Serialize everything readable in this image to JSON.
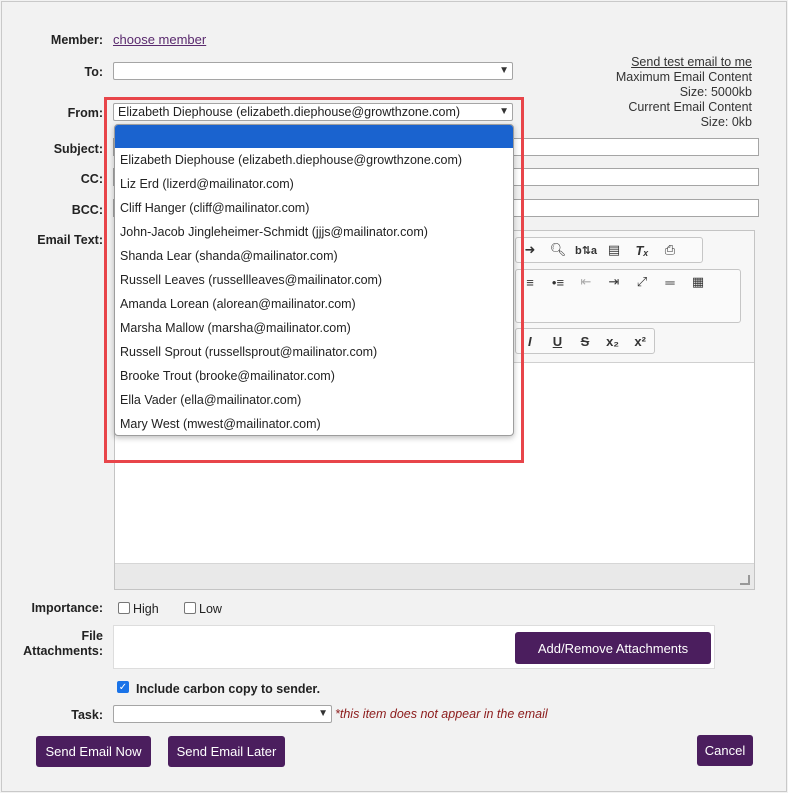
{
  "member": {
    "label": "Member:",
    "link": "choose member"
  },
  "to": {
    "label": "To:",
    "value": ""
  },
  "side_info": {
    "test_link": "Send test email to me",
    "max_line1": "Maximum Email Content",
    "max_line2": "Size: 5000kb",
    "cur_line1": "Current Email Content",
    "cur_line2": "Size: 0kb"
  },
  "from": {
    "label": "From:",
    "value": "Elizabeth Diephouse (elizabeth.diephouse@growthzone.com)",
    "options": [
      "",
      "Elizabeth Diephouse (elizabeth.diephouse@growthzone.com)",
      "Liz Erd (lizerd@mailinator.com)",
      "Cliff Hanger (cliff@mailinator.com)",
      "John-Jacob Jingleheimer-Schmidt (jjjs@mailinator.com)",
      "Shanda Lear (shanda@mailinator.com)",
      "Russell Leaves (russellleaves@mailinator.com)",
      "Amanda Lorean (alorean@mailinator.com)",
      "Marsha Mallow (marsha@mailinator.com)",
      "Russell Sprout (russellsprout@mailinator.com)",
      "Brooke Trout (brooke@mailinator.com)",
      "Ella Vader (ella@mailinator.com)",
      "Mary West (mwest@mailinator.com)"
    ]
  },
  "subject": {
    "label": "Subject:"
  },
  "cc": {
    "label": "CC:"
  },
  "bcc": {
    "label": "BCC:"
  },
  "email_text": {
    "label": "Email Text:"
  },
  "toolbar": {
    "row1": [
      "redo-icon",
      "find-icon",
      "replace-icon",
      "paste-from-word-icon",
      "remove-format-icon",
      "print-icon"
    ],
    "row2": [
      "numbered-list-icon",
      "bulleted-list-icon",
      "outdent-icon",
      "indent-icon",
      "maximize-icon",
      "horizontal-line-icon",
      "table-icon"
    ],
    "row3": [
      "italic-icon",
      "underline-icon",
      "strikethrough-icon",
      "subscript-icon",
      "superscript-icon"
    ]
  },
  "importance": {
    "label": "Importance:",
    "high": "High",
    "low": "Low"
  },
  "attachments": {
    "label_line1": "File",
    "label_line2": "Attachments:",
    "button": "Add/Remove Attachments"
  },
  "carbon_copy": {
    "label": "Include carbon copy to sender.",
    "checked": true
  },
  "task": {
    "label": "Task:",
    "note": "*this item does not appear in the email",
    "value": ""
  },
  "actions": {
    "send_now": "Send Email Now",
    "send_later": "Send Email Later",
    "cancel": "Cancel"
  },
  "colors": {
    "accent": "#4b1e5e",
    "highlight": "#e8454a",
    "selected_option": "#1a63cf",
    "note": "#8b1a1a"
  }
}
